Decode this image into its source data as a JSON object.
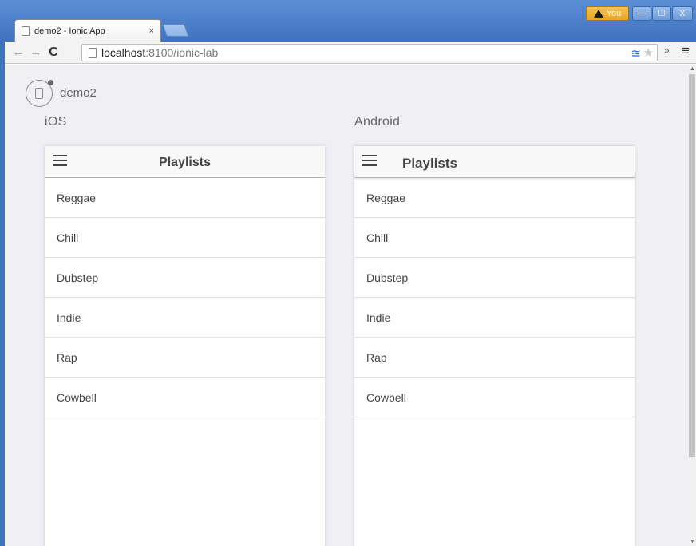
{
  "browser": {
    "tab_title": "demo2 - Ionic App",
    "tab_close": "×",
    "profile_label": "You",
    "window_buttons": {
      "minimize": "—",
      "maximize": "☐",
      "close": "X"
    },
    "url_host": "localhost",
    "url_path": ":8100/ionic-lab",
    "nav": {
      "back": "←",
      "forward": "→",
      "reload": "C"
    },
    "extensions_more": "»",
    "menu": "≡"
  },
  "app": {
    "name": "demo2",
    "platforms": [
      {
        "label": "iOS",
        "header_title": "Playlists",
        "items": [
          "Reggae",
          "Chill",
          "Dubstep",
          "Indie",
          "Rap",
          "Cowbell"
        ]
      },
      {
        "label": "Android",
        "header_title": "Playlists",
        "items": [
          "Reggae",
          "Chill",
          "Dubstep",
          "Indie",
          "Rap",
          "Cowbell"
        ]
      }
    ]
  },
  "colors": {
    "chrome_blue": "#3e73c0",
    "lab_background": "#f0f0f4",
    "header_bg": "#f8f8f8"
  }
}
